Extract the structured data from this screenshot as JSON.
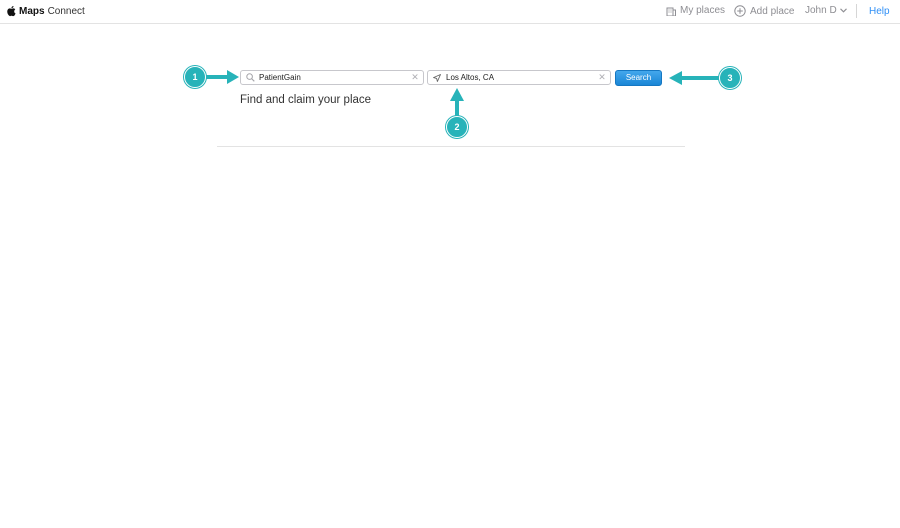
{
  "app": {
    "brand_bold": "Maps",
    "brand_rest": "Connect"
  },
  "nav": {
    "my_places": "My places",
    "add_place": "Add place",
    "user": "John D",
    "help": "Help"
  },
  "search": {
    "query": "PatientGain",
    "location": "Los Altos, CA",
    "button": "Search",
    "headline": "Find and claim your place"
  },
  "callouts": [
    "1",
    "2",
    "3"
  ],
  "colors": {
    "accent": "#27b3b9",
    "link": "#2f8ff6",
    "button": "#1a86d6"
  }
}
